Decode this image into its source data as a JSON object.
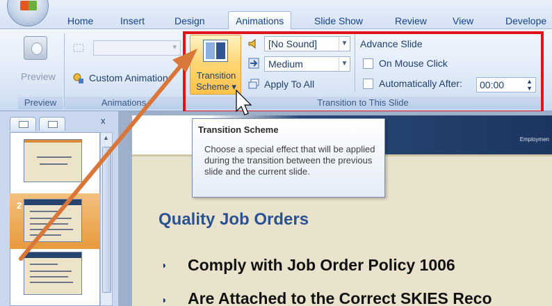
{
  "tabs": [
    "Home",
    "Insert",
    "Design",
    "Animations",
    "Slide Show",
    "Review",
    "View",
    "Develope"
  ],
  "active_tab": "Animations",
  "preview_group": {
    "button_label": "Preview",
    "group_label": "Preview"
  },
  "animations_group": {
    "custom_animation_label": "Custom Animation",
    "group_label": "Animations"
  },
  "transition_group": {
    "scheme_label_line1": "Transition",
    "scheme_label_line2": "Scheme ▾",
    "sound_value": "[No Sound]",
    "speed_value": "Medium",
    "apply_to_all_label": "Apply To All",
    "advance_slide_label": "Advance Slide",
    "on_mouse_click_label": "On Mouse Click",
    "automatically_after_label": "Automatically After:",
    "time_value": "00:00",
    "group_label": "Transition to This Slide"
  },
  "pane": {
    "close_label": "x",
    "slide_numbers": [
      "1",
      "2",
      "3"
    ],
    "selected_slide": "2"
  },
  "tooltip": {
    "title": "Transition Scheme",
    "body": "Choose a special effect that will be applied during the transition between the previous slide and the current slide."
  },
  "slide": {
    "header_text": "Employmen",
    "title": "Quality Job Orders",
    "bullets": [
      "Comply with Job Order Policy 1006",
      "Are Attached to the Correct SKIES Reco"
    ]
  },
  "colors": {
    "highlight_box": "#e0151b",
    "arrow": "#d9763a",
    "title_blue": "#2a5292"
  },
  "icons": [
    "preview-icon",
    "sound-icon",
    "speed-icon",
    "apply-all-icon",
    "custom-animation-icon"
  ]
}
